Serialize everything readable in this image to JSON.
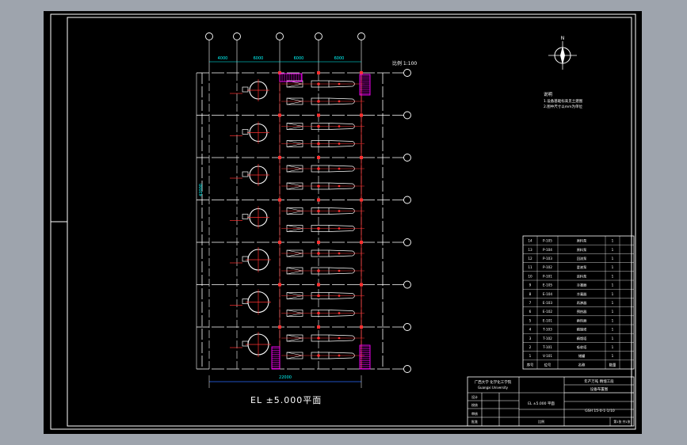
{
  "drawing": {
    "plan_title": "EL  ±5.000平面",
    "scale_note": "比例 1:100",
    "north_label": "N",
    "notes": {
      "heading": "说明",
      "line1": "1.设备基础标高见土建图",
      "line2": "2.图中尺寸以mm为单位"
    },
    "dims": {
      "top": [
        "4000",
        "6000",
        "6000",
        "6000"
      ],
      "left": "42000",
      "bottom": "22000"
    },
    "pump_rows": 7
  },
  "equipment_list": {
    "headers": [
      "序号",
      "位号",
      "名称",
      "数量"
    ],
    "rows": [
      [
        "14",
        "P-105",
        "原料泵",
        "1"
      ],
      [
        "13",
        "P-104",
        "原料泵",
        "1"
      ],
      [
        "12",
        "P-103",
        "回流泵",
        "1"
      ],
      [
        "11",
        "P-102",
        "釜液泵",
        "1"
      ],
      [
        "10",
        "P-101",
        "进料泵",
        "1"
      ],
      [
        "9",
        "E-105",
        "冷凝器",
        "1"
      ],
      [
        "8",
        "E-104",
        "冷凝器",
        "1"
      ],
      [
        "7",
        "E-103",
        "再沸器",
        "1"
      ],
      [
        "6",
        "E-102",
        "预热器",
        "1"
      ],
      [
        "5",
        "E-101",
        "换热器",
        "1"
      ],
      [
        "4",
        "T-103",
        "精馏塔",
        "1"
      ],
      [
        "3",
        "T-102",
        "精馏塔",
        "1"
      ],
      [
        "2",
        "T-101",
        "吸收塔",
        "1"
      ],
      [
        "1",
        "V-101",
        "储罐",
        "1"
      ]
    ]
  },
  "title_block": {
    "school": "广西大学 化学化工学院",
    "school_en": "Guangxi University",
    "project": "年产万吨 精馏工段",
    "project2": "设备布置图",
    "drawing_name": "EL ±5.000 平面",
    "drawing_no": "GSH 15-0-1-1/10",
    "labels": [
      "设计",
      "校核",
      "审核",
      "批准"
    ],
    "scale_label": "比例",
    "sheet_label": "第1张 共1张"
  }
}
